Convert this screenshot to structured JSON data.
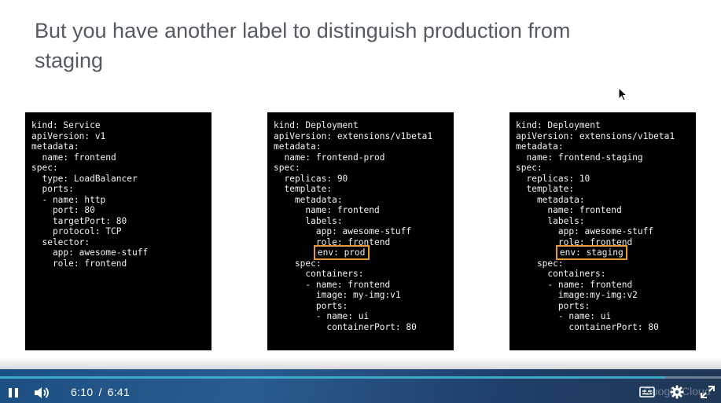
{
  "slide": {
    "title_line1": "But you have another label to distinguish production from",
    "title_line2": "staging"
  },
  "code_panels": [
    {
      "lines": [
        "kind: Service",
        "apiVersion: v1",
        "metadata:",
        "  name: frontend",
        "spec:",
        "  type: LoadBalancer",
        "  ports:",
        "  - name: http",
        "    port: 80",
        "    targetPort: 80",
        "    protocol: TCP",
        "  selector:",
        "    app: awesome-stuff",
        "    role: frontend"
      ]
    },
    {
      "lines": [
        "kind: Deployment",
        "apiVersion: extensions/v1beta1",
        "metadata:",
        "  name: frontend-prod",
        "spec:",
        "  replicas: 90",
        "  template:",
        "    metadata:",
        "      name: frontend",
        "      labels:",
        "        app: awesome-stuff",
        "        role: frontend",
        "        env: prod",
        "    spec:",
        "      containers:",
        "      - name: frontend",
        "        image: my-img:v1",
        "        ports:",
        "        - name: ui",
        "          containerPort: 80"
      ],
      "highlight_line": 12
    },
    {
      "lines": [
        "kind: Deployment",
        "apiVersion: extensions/v1beta1",
        "metadata:",
        "  name: frontend-staging",
        "spec:",
        "  replicas: 10",
        "  template:",
        "    metadata:",
        "      name: frontend",
        "      labels:",
        "        app: awesome-stuff",
        "        role: frontend",
        "        env: staging",
        "    spec:",
        "      containers:",
        "      - name: frontend",
        "        image:my-img:v2",
        "        ports:",
        "        - name: ui",
        "          containerPort: 80"
      ],
      "highlight_line": 12
    }
  ],
  "player": {
    "current_time": "6:10",
    "separator": "/",
    "duration": "6:41",
    "progress_fraction": 0.923,
    "watermark": "Google Cloud",
    "icons": {
      "pause": "pause-icon",
      "volume": "volume-icon",
      "captions": "captions-icon",
      "settings": "gear-icon",
      "fullscreen": "fullscreen-icon"
    }
  },
  "colors": {
    "highlight": "#e89a3a",
    "progress": "#3ea8c6",
    "title": "#555a60"
  }
}
